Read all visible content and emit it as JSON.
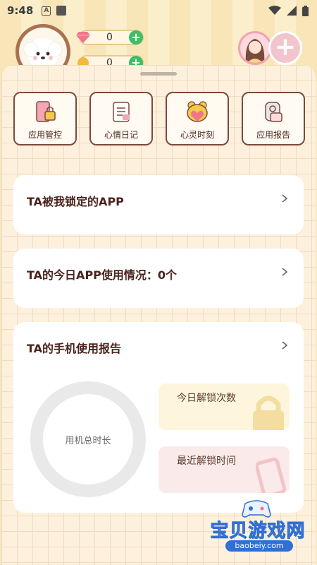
{
  "status_bar": {
    "time": "9:48",
    "a_badge": "A"
  },
  "header": {
    "gem_count": "0",
    "coin_count": "0"
  },
  "tiles": [
    {
      "label": "应用管控",
      "icon": "phone-lock-icon"
    },
    {
      "label": "心情日记",
      "icon": "diary-icon"
    },
    {
      "label": "心灵时刻",
      "icon": "heart-bear-icon"
    },
    {
      "label": "应用报告",
      "icon": "report-icon"
    }
  ],
  "cards": {
    "locked_apps": {
      "title": "TA被我锁定的APP"
    },
    "today_usage": {
      "title": "TA的今日APP使用情况：0个"
    },
    "phone_report": {
      "title": "TA的手机使用报告",
      "ring_label": "用机总时长",
      "unlock_count_label": "今日解锁次数",
      "recent_unlock_label": "最近解锁时间"
    }
  },
  "watermark": {
    "text": "宝贝游戏网",
    "url": "baobeiy.com"
  },
  "colors": {
    "accent_brown": "#7d4a3a",
    "plus_green": "#3cc063",
    "unlock_card": "#fdf6dc",
    "recent_card": "#fbeaea"
  }
}
